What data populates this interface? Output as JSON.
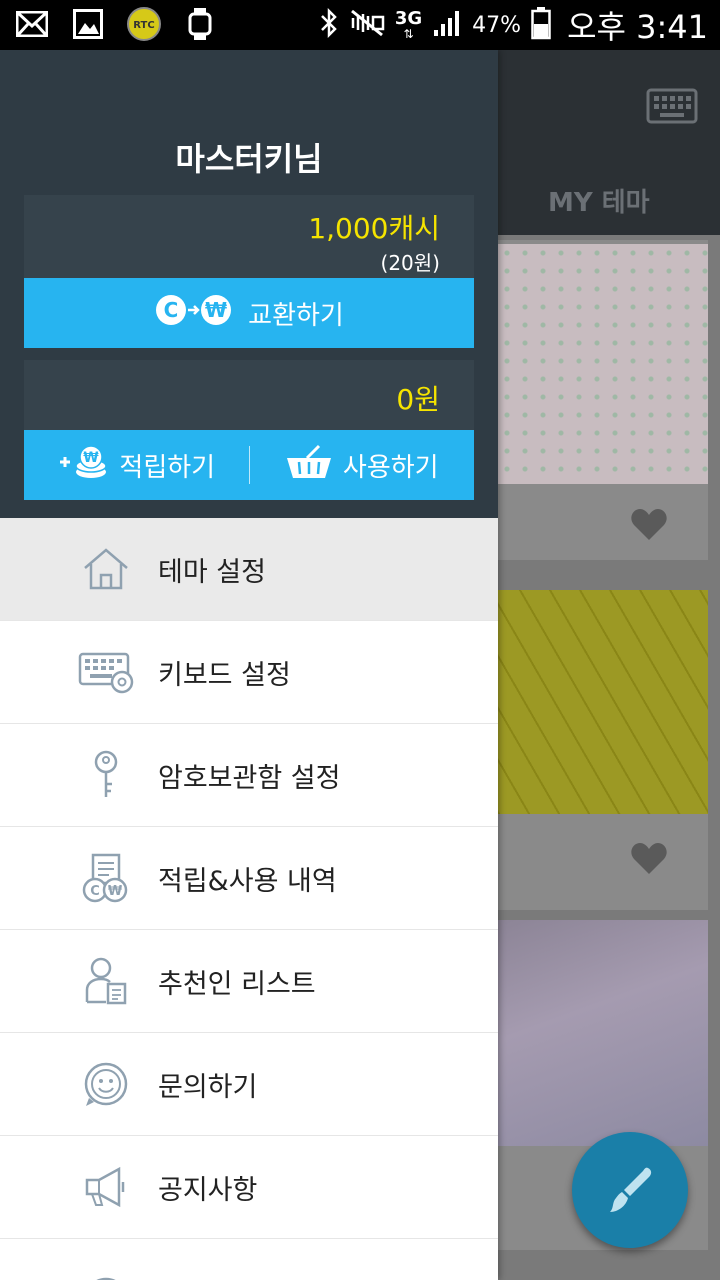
{
  "status_bar": {
    "network": "3G",
    "battery": "47%",
    "time": "오후 3:41",
    "left_icons": [
      "mail-icon",
      "image-icon",
      "rtc-icon",
      "watch-icon"
    ],
    "rtc_label": "RTC",
    "right_icons": [
      "bluetooth-icon",
      "mute-icon",
      "signal-icon",
      "battery-icon"
    ]
  },
  "drawer": {
    "username": "마스터키님",
    "cash_box": {
      "amount": "1,000캐시",
      "sub": "(20원)",
      "exchange_label": "교환하기"
    },
    "won_box": {
      "amount": "0원",
      "earn_label": "적립하기",
      "use_label": "사용하기"
    },
    "menu": [
      {
        "label": "테마 설정",
        "icon": "home-icon",
        "active": true
      },
      {
        "label": "키보드 설정",
        "icon": "keyboard-settings-icon",
        "active": false
      },
      {
        "label": "암호보관함 설정",
        "icon": "key-icon",
        "active": false
      },
      {
        "label": "적립&사용 내역",
        "icon": "history-icon",
        "active": false
      },
      {
        "label": "추천인 리스트",
        "icon": "recommender-icon",
        "active": false
      },
      {
        "label": "문의하기",
        "icon": "smile-icon",
        "active": false
      },
      {
        "label": "공지사항",
        "icon": "megaphone-icon",
        "active": false
      }
    ]
  },
  "background": {
    "tab_label": "MY 테마"
  },
  "colors": {
    "accent": "#27b4f0",
    "header": "#2f3b44",
    "amount": "#f5e400"
  }
}
